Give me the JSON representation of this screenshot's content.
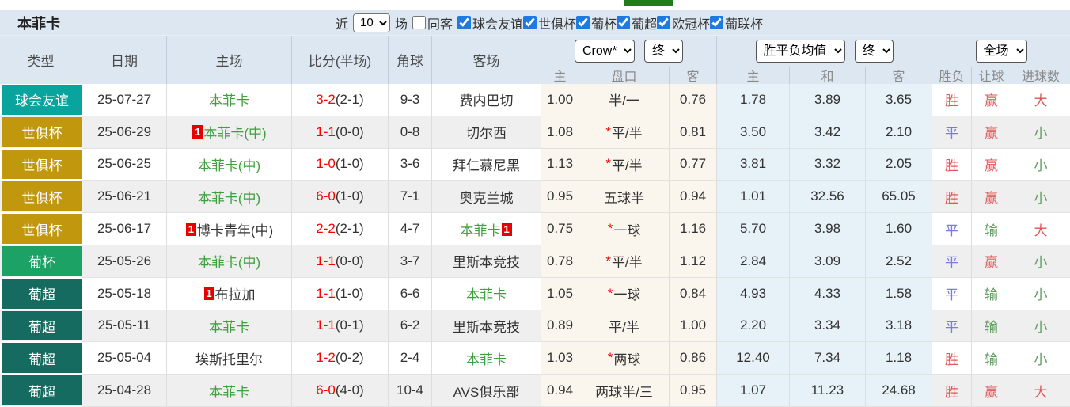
{
  "title": "本菲卡",
  "topbar": {
    "near_label": "近",
    "near_value": "10",
    "matches_label": "场",
    "same_away": {
      "label": "同客",
      "checked": false
    },
    "competitions": [
      {
        "label": "球会友谊",
        "checked": true
      },
      {
        "label": "世俱杯",
        "checked": true
      },
      {
        "label": "葡杯",
        "checked": true
      },
      {
        "label": "葡超",
        "checked": true
      },
      {
        "label": "欧冠杯",
        "checked": true
      },
      {
        "label": "葡联杯",
        "checked": true
      }
    ]
  },
  "header": {
    "columns": [
      "类型",
      "日期",
      "主场",
      "比分(半场)",
      "角球",
      "客场"
    ],
    "odds_dropdown": "Crow*",
    "odds_time_dropdown": "终",
    "odds_subcolumns": [
      "主",
      "盘口",
      "客"
    ],
    "avg_dropdown": "胜平负均值",
    "avg_time_dropdown": "终",
    "avg_subcolumns": [
      "主",
      "和",
      "客"
    ],
    "scope_dropdown": "全场",
    "result_columns": [
      "胜负",
      "让球",
      "进球数"
    ]
  },
  "type_colors": {
    "球会友谊": "#0aa49e",
    "世俱杯": "#c1970e",
    "葡杯": "#1ba264",
    "葡超": "#166b60"
  },
  "colors": {
    "win_red": "#e25555",
    "draw_blue": "#7b7be0",
    "loss_green": "#5f9e5f",
    "team_green": "#3fa03f",
    "score_red": "#fe0000",
    "badge_red": "#e60000",
    "header_bg": "#dde7f1",
    "crow_col_bg": "#faf6ee",
    "avg_col_bg": "#e6f1f8"
  },
  "rows": [
    {
      "type": "球会友谊",
      "date": "25-07-27",
      "home": {
        "text": "本菲卡",
        "green": true,
        "badge_before": false,
        "badge_after": false
      },
      "score": "3-2",
      "half": "(2-1)",
      "corners": "9-3",
      "away": {
        "text": "费内巴切",
        "green": false,
        "badge_before": false,
        "badge_after": false
      },
      "odds": {
        "home": "1.00",
        "star": false,
        "handicap": "半/一",
        "away": "0.76"
      },
      "avg": {
        "home": "1.78",
        "draw": "3.89",
        "away": "3.65"
      },
      "results": [
        {
          "text": "胜",
          "color": "red"
        },
        {
          "text": "赢",
          "color": "red"
        },
        {
          "text": "大",
          "color": "red"
        }
      ]
    },
    {
      "type": "世俱杯",
      "date": "25-06-29",
      "home": {
        "text": "本菲卡(中)",
        "green": true,
        "badge_before": true,
        "badge_after": false
      },
      "score": "1-1",
      "half": "(0-0)",
      "corners": "0-8",
      "away": {
        "text": "切尔西",
        "green": false,
        "badge_before": false,
        "badge_after": false
      },
      "odds": {
        "home": "1.08",
        "star": true,
        "handicap": "平/半",
        "away": "0.81"
      },
      "avg": {
        "home": "3.50",
        "draw": "3.42",
        "away": "2.10"
      },
      "results": [
        {
          "text": "平",
          "color": "blue"
        },
        {
          "text": "赢",
          "color": "red"
        },
        {
          "text": "小",
          "color": "green"
        }
      ]
    },
    {
      "type": "世俱杯",
      "date": "25-06-25",
      "home": {
        "text": "本菲卡(中)",
        "green": true,
        "badge_before": false,
        "badge_after": false
      },
      "score": "1-0",
      "half": "(1-0)",
      "corners": "3-6",
      "away": {
        "text": "拜仁慕尼黑",
        "green": false,
        "badge_before": false,
        "badge_after": false
      },
      "odds": {
        "home": "1.13",
        "star": true,
        "handicap": "平/半",
        "away": "0.77"
      },
      "avg": {
        "home": "3.81",
        "draw": "3.32",
        "away": "2.05"
      },
      "results": [
        {
          "text": "胜",
          "color": "red"
        },
        {
          "text": "赢",
          "color": "red"
        },
        {
          "text": "小",
          "color": "green"
        }
      ]
    },
    {
      "type": "世俱杯",
      "date": "25-06-21",
      "home": {
        "text": "本菲卡(中)",
        "green": true,
        "badge_before": false,
        "badge_after": false
      },
      "score": "6-0",
      "half": "(1-0)",
      "corners": "7-1",
      "away": {
        "text": "奥克兰城",
        "green": false,
        "badge_before": false,
        "badge_after": false
      },
      "odds": {
        "home": "0.95",
        "star": false,
        "handicap": "五球半",
        "away": "0.94"
      },
      "avg": {
        "home": "1.01",
        "draw": "32.56",
        "away": "65.05"
      },
      "results": [
        {
          "text": "胜",
          "color": "red"
        },
        {
          "text": "赢",
          "color": "red"
        },
        {
          "text": "小",
          "color": "green"
        }
      ]
    },
    {
      "type": "世俱杯",
      "date": "25-06-17",
      "home": {
        "text": "博卡青年(中)",
        "green": false,
        "badge_before": true,
        "badge_after": false
      },
      "score": "2-2",
      "half": "(2-1)",
      "corners": "4-7",
      "away": {
        "text": "本菲卡",
        "green": true,
        "badge_before": false,
        "badge_after": true
      },
      "odds": {
        "home": "0.75",
        "star": true,
        "handicap": "一球",
        "away": "1.16"
      },
      "avg": {
        "home": "5.70",
        "draw": "3.98",
        "away": "1.60"
      },
      "results": [
        {
          "text": "平",
          "color": "blue"
        },
        {
          "text": "输",
          "color": "green"
        },
        {
          "text": "大",
          "color": "red"
        }
      ]
    },
    {
      "type": "葡杯",
      "date": "25-05-26",
      "home": {
        "text": "本菲卡(中)",
        "green": true,
        "badge_before": false,
        "badge_after": false
      },
      "score": "1-1",
      "half": "(0-0)",
      "corners": "3-7",
      "away": {
        "text": "里斯本竞技",
        "green": false,
        "badge_before": false,
        "badge_after": false
      },
      "odds": {
        "home": "0.78",
        "star": true,
        "handicap": "平/半",
        "away": "1.12"
      },
      "avg": {
        "home": "2.84",
        "draw": "3.09",
        "away": "2.52"
      },
      "results": [
        {
          "text": "平",
          "color": "blue"
        },
        {
          "text": "赢",
          "color": "red"
        },
        {
          "text": "小",
          "color": "green"
        }
      ]
    },
    {
      "type": "葡超",
      "date": "25-05-18",
      "home": {
        "text": "布拉加",
        "green": false,
        "badge_before": true,
        "badge_after": false
      },
      "score": "1-1",
      "half": "(1-0)",
      "corners": "6-6",
      "away": {
        "text": "本菲卡",
        "green": true,
        "badge_before": false,
        "badge_after": false
      },
      "odds": {
        "home": "1.05",
        "star": true,
        "handicap": "一球",
        "away": "0.84"
      },
      "avg": {
        "home": "4.93",
        "draw": "4.33",
        "away": "1.58"
      },
      "results": [
        {
          "text": "平",
          "color": "blue"
        },
        {
          "text": "输",
          "color": "green"
        },
        {
          "text": "小",
          "color": "green"
        }
      ]
    },
    {
      "type": "葡超",
      "date": "25-05-11",
      "home": {
        "text": "本菲卡",
        "green": true,
        "badge_before": false,
        "badge_after": false
      },
      "score": "1-1",
      "half": "(0-1)",
      "corners": "6-2",
      "away": {
        "text": "里斯本竞技",
        "green": false,
        "badge_before": false,
        "badge_after": false
      },
      "odds": {
        "home": "0.89",
        "star": false,
        "handicap": "平/半",
        "away": "1.00"
      },
      "avg": {
        "home": "2.20",
        "draw": "3.34",
        "away": "3.18"
      },
      "results": [
        {
          "text": "平",
          "color": "blue"
        },
        {
          "text": "输",
          "color": "green"
        },
        {
          "text": "小",
          "color": "green"
        }
      ]
    },
    {
      "type": "葡超",
      "date": "25-05-04",
      "home": {
        "text": "埃斯托里尔",
        "green": false,
        "badge_before": false,
        "badge_after": false
      },
      "score": "1-2",
      "half": "(0-2)",
      "corners": "2-4",
      "away": {
        "text": "本菲卡",
        "green": true,
        "badge_before": false,
        "badge_after": false
      },
      "odds": {
        "home": "1.03",
        "star": true,
        "handicap": "两球",
        "away": "0.86"
      },
      "avg": {
        "home": "12.40",
        "draw": "7.34",
        "away": "1.18"
      },
      "results": [
        {
          "text": "胜",
          "color": "red"
        },
        {
          "text": "输",
          "color": "green"
        },
        {
          "text": "小",
          "color": "green"
        }
      ]
    },
    {
      "type": "葡超",
      "date": "25-04-28",
      "home": {
        "text": "本菲卡",
        "green": true,
        "badge_before": false,
        "badge_after": false
      },
      "score": "6-0",
      "half": "(4-0)",
      "corners": "10-4",
      "away": {
        "text": "AVS俱乐部",
        "green": false,
        "badge_before": false,
        "badge_after": false
      },
      "odds": {
        "home": "0.94",
        "star": false,
        "handicap": "两球半/三",
        "away": "0.95"
      },
      "avg": {
        "home": "1.07",
        "draw": "11.23",
        "away": "24.68"
      },
      "results": [
        {
          "text": "胜",
          "color": "red"
        },
        {
          "text": "赢",
          "color": "red"
        },
        {
          "text": "大",
          "color": "red"
        }
      ]
    }
  ]
}
